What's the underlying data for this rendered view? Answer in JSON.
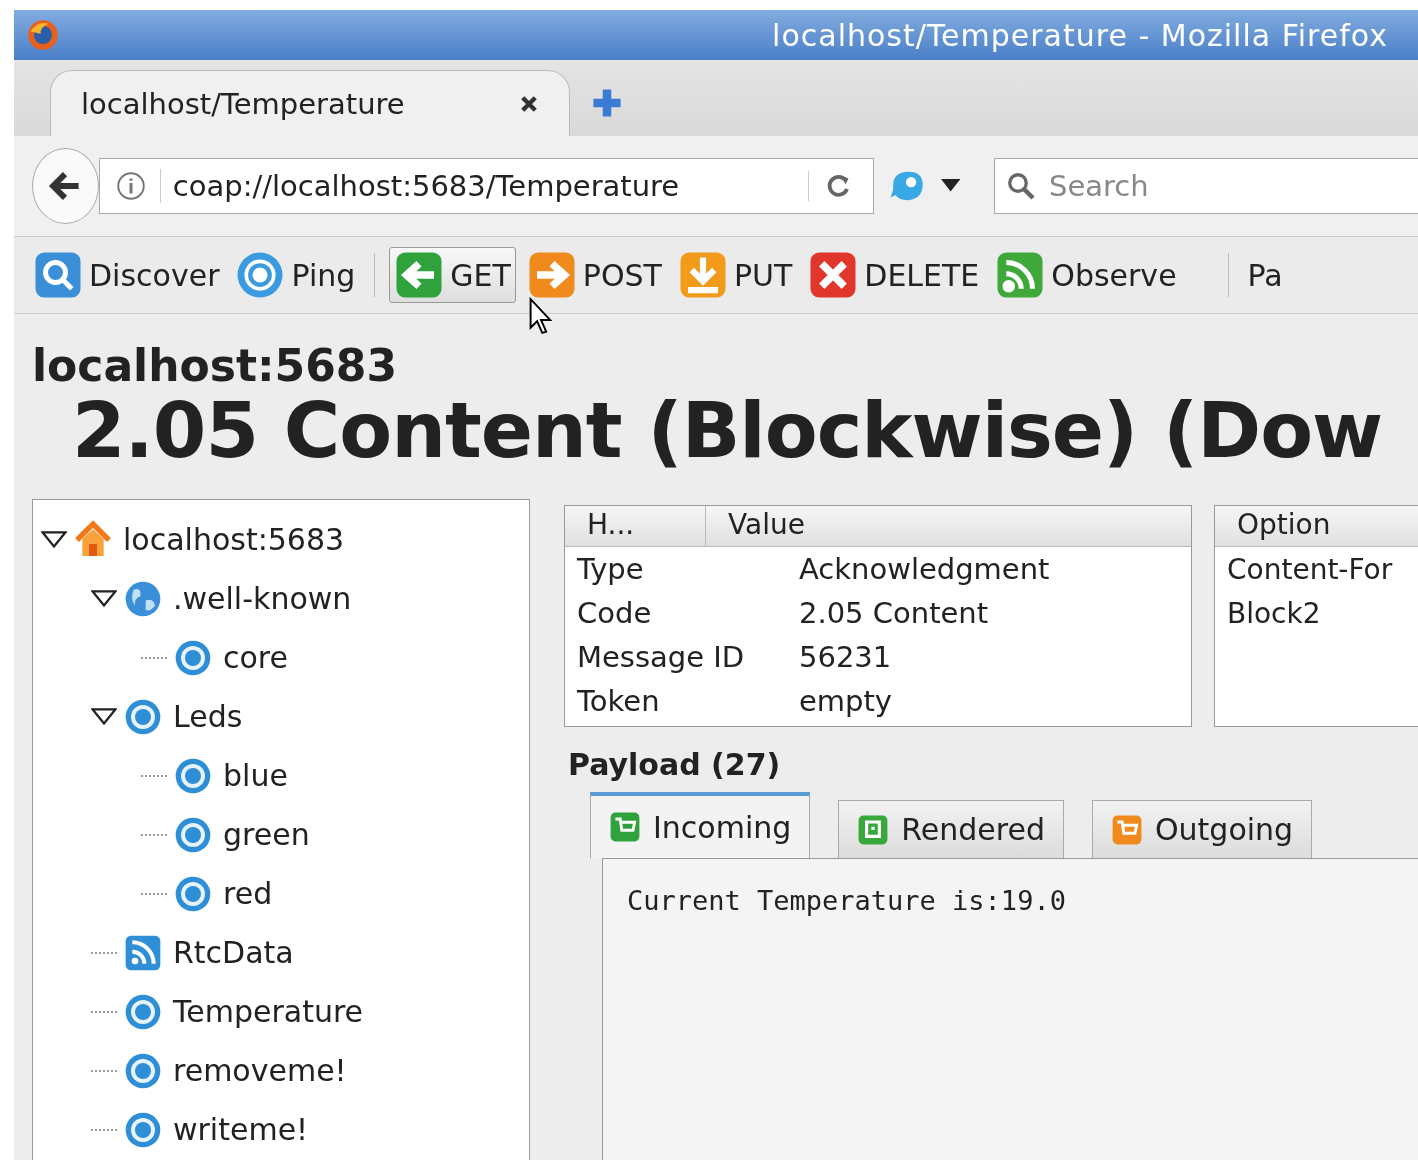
{
  "window": {
    "title": "localhost/Temperature - Mozilla Firefox"
  },
  "tabs": [
    {
      "label": "localhost/Temperature",
      "selected": true
    }
  ],
  "address_bar": {
    "url": "coap://localhost:5683/Temperature"
  },
  "search": {
    "placeholder": "Search"
  },
  "toolbar": [
    {
      "label": "Discover",
      "kind": "discover",
      "selected": false
    },
    {
      "label": "Ping",
      "kind": "ping",
      "selected": false
    },
    {
      "kind": "separator"
    },
    {
      "label": "GET",
      "kind": "get",
      "selected": true
    },
    {
      "label": "POST",
      "kind": "post",
      "selected": false
    },
    {
      "label": "PUT",
      "kind": "put",
      "selected": false
    },
    {
      "label": "DELETE",
      "kind": "delete",
      "selected": false
    },
    {
      "label": "Observe",
      "kind": "observe",
      "selected": false
    },
    {
      "kind": "separator"
    },
    {
      "label": "Pa",
      "kind": "text",
      "selected": false
    }
  ],
  "host": "localhost:5683",
  "status": "2.05 Content (Blockwise) (Dow",
  "tree": [
    {
      "label": "localhost:5683",
      "kind": "home",
      "expanded": true,
      "children": [
        {
          "label": ".well-known",
          "kind": "globe",
          "expanded": true,
          "children": [
            {
              "label": "core",
              "kind": "resource"
            }
          ]
        },
        {
          "label": "Leds",
          "kind": "resource",
          "expanded": true,
          "children": [
            {
              "label": "blue",
              "kind": "resource"
            },
            {
              "label": "green",
              "kind": "resource"
            },
            {
              "label": "red",
              "kind": "resource"
            }
          ]
        },
        {
          "label": "RtcData",
          "kind": "feed"
        },
        {
          "label": "Temperature",
          "kind": "resource"
        },
        {
          "label": "removeme!",
          "kind": "resource"
        },
        {
          "label": "writeme!",
          "kind": "resource"
        }
      ]
    }
  ],
  "headers": {
    "columns": [
      "H...",
      "Value"
    ],
    "rows": [
      [
        "Type",
        "Acknowledgment"
      ],
      [
        "Code",
        "2.05 Content"
      ],
      [
        "Message ID",
        "56231"
      ],
      [
        "Token",
        "empty"
      ]
    ]
  },
  "options": {
    "columns": [
      "Option"
    ],
    "rows": [
      [
        "Content-For"
      ],
      [
        "Block2"
      ]
    ]
  },
  "payload": {
    "title": "Payload (27)",
    "tabs": [
      {
        "label": "Incoming",
        "kind": "incoming",
        "selected": true
      },
      {
        "label": "Rendered",
        "kind": "rendered",
        "selected": false
      },
      {
        "label": "Outgoing",
        "kind": "outgoing",
        "selected": false
      }
    ],
    "text": "Current Temperature is:19.0"
  }
}
